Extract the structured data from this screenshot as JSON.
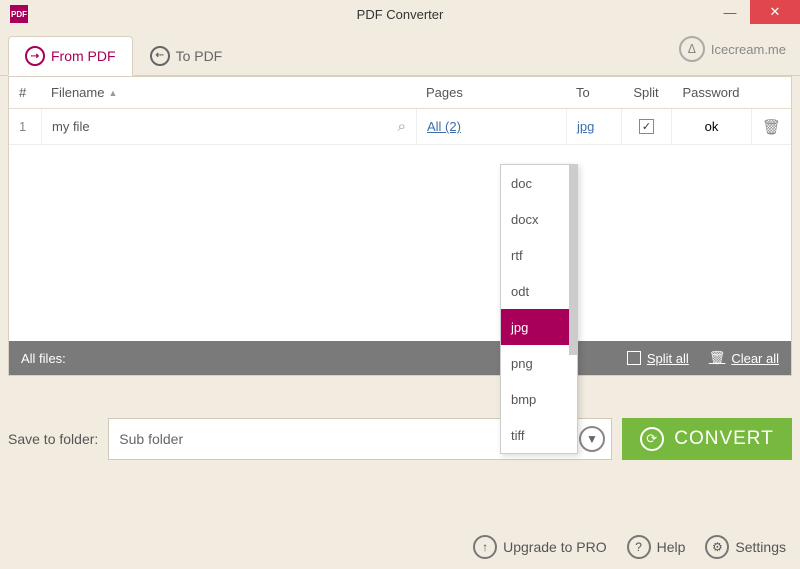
{
  "window": {
    "title": "PDF Converter",
    "app_icon_text": "PDF"
  },
  "tabs": {
    "from": "From PDF",
    "to": "To PDF"
  },
  "brand": "Icecream.me",
  "table": {
    "header": {
      "num": "#",
      "filename": "Filename",
      "pages": "Pages",
      "to": "To",
      "split": "Split",
      "password": "Password"
    },
    "row": {
      "num": "1",
      "filename": "my file",
      "pages": "All (2)",
      "to": "jpg",
      "split_checked": "✓",
      "password": "ok"
    }
  },
  "allfiles": {
    "label": "All files:",
    "split_all": "Split all",
    "clear_all": "Clear all"
  },
  "dropdown_options": [
    "doc",
    "docx",
    "rtf",
    "odt",
    "jpg",
    "png",
    "bmp",
    "tiff"
  ],
  "dropdown_selected": "jpg",
  "save": {
    "label": "Save to folder:",
    "value": "Sub folder"
  },
  "convert": "CONVERT",
  "footer": {
    "upgrade": "Upgrade to PRO",
    "help": "Help",
    "settings": "Settings"
  }
}
